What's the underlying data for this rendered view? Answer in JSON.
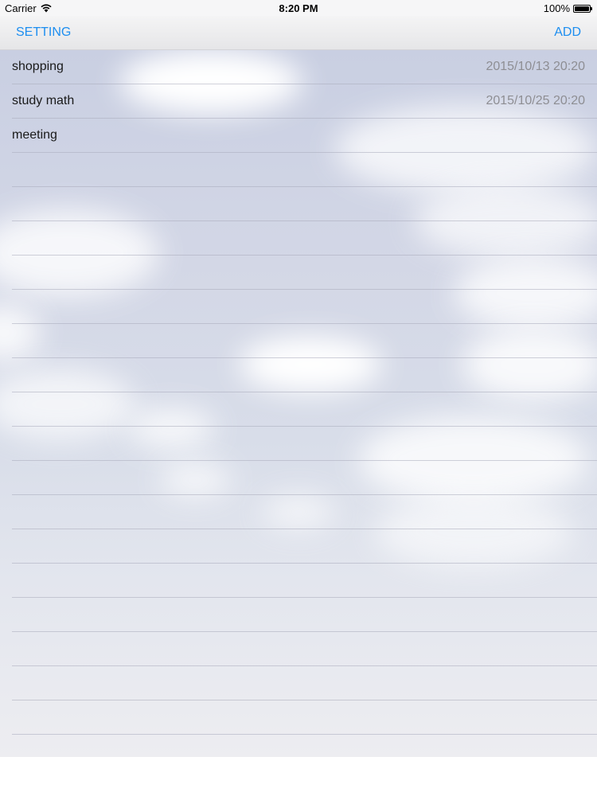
{
  "status_bar": {
    "carrier": "Carrier",
    "wifi_icon": "wifi-icon",
    "time": "8:20 PM",
    "battery_percent": "100%",
    "battery_level": 1.0,
    "battery_icon": "battery-icon"
  },
  "nav": {
    "left_label": "SETTING",
    "right_label": "ADD",
    "accent_color": "#1d8ef0"
  },
  "tasks": [
    {
      "title": "shopping",
      "date": "2015/10/13 20:20"
    },
    {
      "title": "study math",
      "date": "2015/10/25 20:20"
    },
    {
      "title": "meeting",
      "date": ""
    },
    {
      "title": "",
      "date": ""
    },
    {
      "title": "",
      "date": ""
    },
    {
      "title": "",
      "date": ""
    },
    {
      "title": "",
      "date": ""
    },
    {
      "title": "",
      "date": ""
    },
    {
      "title": "",
      "date": ""
    },
    {
      "title": "",
      "date": ""
    },
    {
      "title": "",
      "date": ""
    },
    {
      "title": "",
      "date": ""
    },
    {
      "title": "",
      "date": ""
    },
    {
      "title": "",
      "date": ""
    },
    {
      "title": "",
      "date": ""
    },
    {
      "title": "",
      "date": ""
    },
    {
      "title": "",
      "date": ""
    },
    {
      "title": "",
      "date": ""
    },
    {
      "title": "",
      "date": ""
    },
    {
      "title": "",
      "date": ""
    }
  ]
}
